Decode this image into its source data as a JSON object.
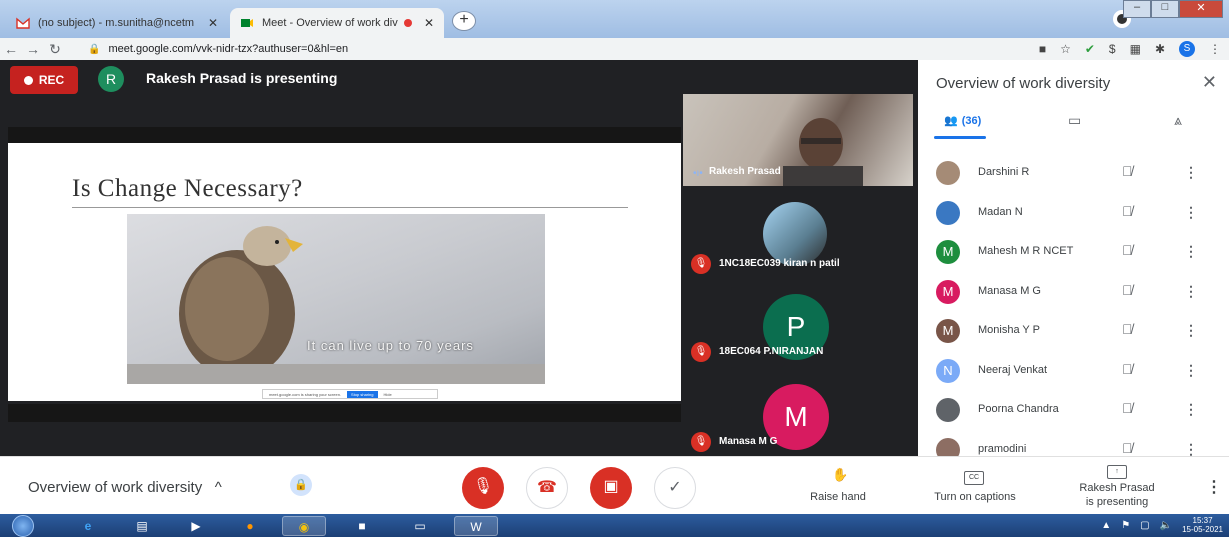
{
  "browser": {
    "tabs": [
      {
        "title": "(no subject) - m.sunitha@ncetm",
        "active": false
      },
      {
        "title": "Meet - Overview of work div",
        "active": true
      }
    ],
    "url": "meet.google.com/vvk-nidr-tzx?authuser=0&hl=en",
    "profile_initial": "S"
  },
  "meet": {
    "rec_label": "REC",
    "presenter_initial": "R",
    "presenting_banner": "Rakesh Prasad is presenting",
    "slide": {
      "title": "Is Change Necessary?",
      "caption": "It can live up to 70 years",
      "share_text": "meet.google.com is sharing your screen.",
      "stop_label": "Stop sharing",
      "hide_label": "Hide"
    },
    "tiles": [
      {
        "name": "Rakesh Prasad"
      },
      {
        "name": "1NC18EC039 kiran n patil"
      },
      {
        "name": "18EC064 P.NIRANJAN",
        "initial": "P"
      },
      {
        "name": "Manasa M G",
        "initial": "M"
      }
    ]
  },
  "panel": {
    "title": "Overview of work diversity",
    "people_count": "(36)",
    "participants": [
      {
        "name": "Darshini R",
        "initial": "",
        "color": "#a58b76"
      },
      {
        "name": "Madan N",
        "initial": "",
        "color": "#3a78c2"
      },
      {
        "name": "Mahesh M R NCET",
        "initial": "M",
        "color": "#1e8e3e"
      },
      {
        "name": "Manasa M G",
        "initial": "M",
        "color": "#d81b60"
      },
      {
        "name": "Monisha Y P",
        "initial": "M",
        "color": "#795548"
      },
      {
        "name": "Neeraj Venkat",
        "initial": "N",
        "color": "#7baaf7"
      },
      {
        "name": "Poorna Chandra",
        "initial": "",
        "color": "#5f6368"
      },
      {
        "name": "pramodini",
        "initial": "",
        "color": "#8d6e63"
      }
    ]
  },
  "controls": {
    "meeting_name": "Overview of work diversity",
    "raise_hand": "Raise hand",
    "captions": "Turn on captions",
    "present_line1": "Rakesh Prasad",
    "present_line2": "is presenting"
  },
  "taskbar": {
    "time": "15:37",
    "date": "15-05-2021"
  }
}
